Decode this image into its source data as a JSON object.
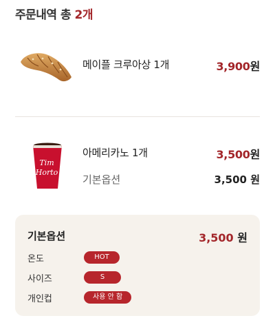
{
  "header": {
    "prefix": "주문내역 총 ",
    "count": "2개"
  },
  "items": [
    {
      "name": "메이플 크루아상 1개",
      "price": "3,900",
      "unit": "원",
      "image": "croissant-image"
    },
    {
      "name": "아메리카노 1개",
      "price": "3,500",
      "unit": "원",
      "image": "coffee-cup-image",
      "cup_text": [
        "Tim",
        "Horto"
      ],
      "option": {
        "label": "기본옵션",
        "price": "3,500 원"
      }
    }
  ],
  "option_panel": {
    "title": "기본옵션",
    "price": "3,500",
    "unit": "원",
    "rows": [
      {
        "label": "온도",
        "value": "HOT"
      },
      {
        "label": "사이즈",
        "value": "S"
      },
      {
        "label": "개인컵",
        "value": "사용 안 함"
      }
    ]
  },
  "colors": {
    "accent": "#a3262a",
    "panel_bg": "#f6f2ec",
    "chip_bg": "#b7262c"
  }
}
